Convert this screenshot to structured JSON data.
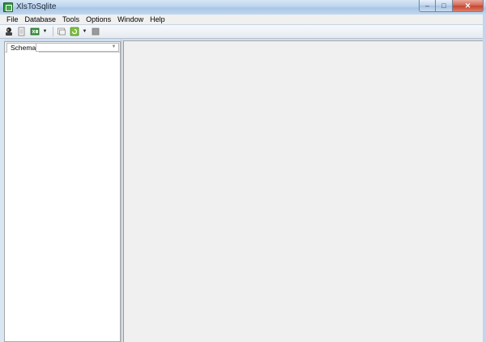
{
  "window": {
    "title": "XlsToSqlite",
    "controls": {
      "minimize": "–",
      "maximize": "□",
      "close": "✕"
    }
  },
  "menu": [
    "File",
    "Database",
    "Tools",
    "Options",
    "Window",
    "Help"
  ],
  "toolbar": {
    "buttons": [
      {
        "icon": "connect-icon"
      },
      {
        "icon": "open-file-icon"
      },
      {
        "icon": "import-excel-icon"
      },
      {
        "icon": "export-icon"
      },
      {
        "icon": "refresh-icon"
      },
      {
        "icon": "stop-icon"
      }
    ]
  },
  "schema_panel": {
    "tab_label": "Schema",
    "selector_value": ""
  },
  "colors": {
    "workspace": "#f0f0f0",
    "panel": "#ffffff",
    "titlebar": "#bcd4ee"
  }
}
